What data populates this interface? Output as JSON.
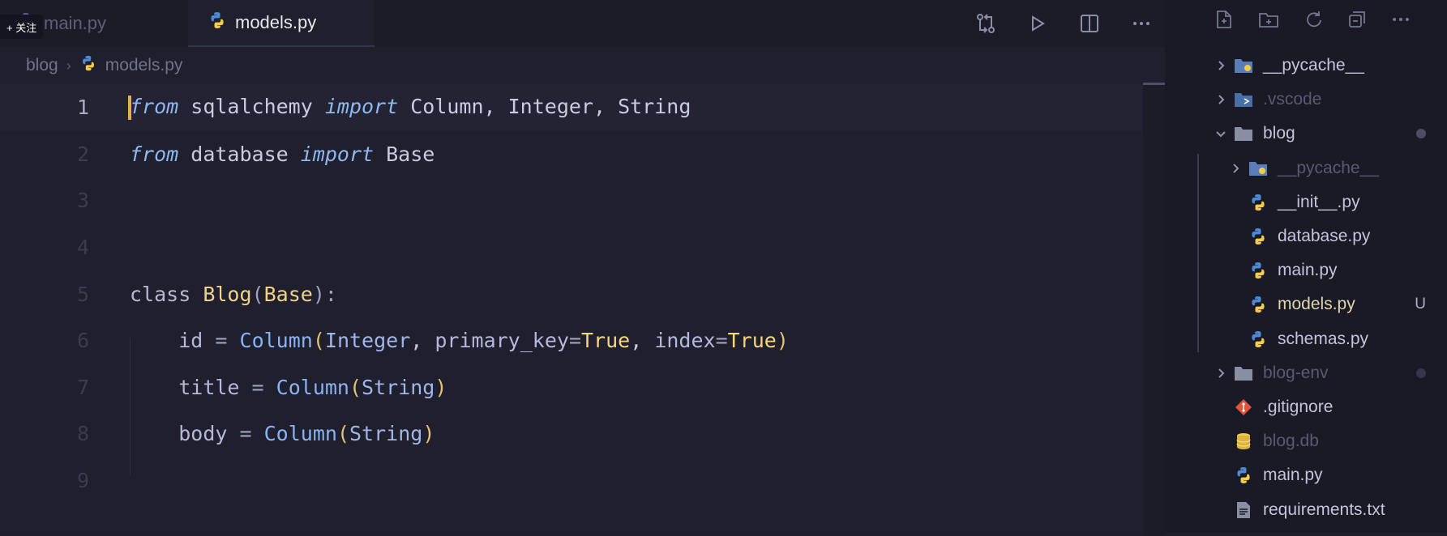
{
  "tabs": [
    {
      "label": "main.py",
      "active": false
    },
    {
      "label": "models.py",
      "active": true
    }
  ],
  "follow_badge": "+ 关注",
  "tab_actions": [
    "compare-changes-icon",
    "run-icon",
    "split-editor-icon",
    "more-icon"
  ],
  "breadcrumb": {
    "folder": "blog",
    "file": "models.py"
  },
  "code": {
    "line_numbers": [
      "1",
      "2",
      "3",
      "4",
      "5",
      "6",
      "7",
      "8",
      "9"
    ],
    "current_line": 1
  },
  "explorer": {
    "actions": [
      "new-file-icon",
      "new-folder-icon",
      "refresh-icon",
      "collapse-icon",
      "more-icon"
    ],
    "items": [
      {
        "label": "__pycache__",
        "type": "folder-python",
        "depth": 0,
        "expanded": false,
        "dim": false
      },
      {
        "label": ".vscode",
        "type": "folder-vscode",
        "depth": 0,
        "expanded": false,
        "dim": true
      },
      {
        "label": "blog",
        "type": "folder",
        "depth": 0,
        "expanded": true,
        "dim": false,
        "badge": "dot"
      },
      {
        "label": "__pycache__",
        "type": "folder-python",
        "depth": 1,
        "expanded": false,
        "dim": true
      },
      {
        "label": "__init__.py",
        "type": "python",
        "depth": 1,
        "dim": false
      },
      {
        "label": "database.py",
        "type": "python",
        "depth": 1,
        "dim": false
      },
      {
        "label": "main.py",
        "type": "python",
        "depth": 1,
        "dim": false
      },
      {
        "label": "models.py",
        "type": "python",
        "depth": 1,
        "dim": false,
        "status": "U"
      },
      {
        "label": "schemas.py",
        "type": "python",
        "depth": 1,
        "dim": false
      },
      {
        "label": "blog-env",
        "type": "folder",
        "depth": 0,
        "expanded": false,
        "dim": true,
        "badge": "dot"
      },
      {
        "label": ".gitignore",
        "type": "git",
        "depth": 0,
        "dim": false
      },
      {
        "label": "blog.db",
        "type": "database",
        "depth": 0,
        "dim": true
      },
      {
        "label": "main.py",
        "type": "python",
        "depth": 0,
        "dim": false
      },
      {
        "label": "requirements.txt",
        "type": "text",
        "depth": 0,
        "dim": false
      }
    ]
  },
  "colors": {
    "editor_bg": "#1f1f2d",
    "sidebar_bg": "#1a1a26",
    "cursor": "#e5b04a",
    "keyword_italic": "#8fb8f0",
    "class_name": "#f1d38a",
    "boolean": "#f5d580"
  }
}
